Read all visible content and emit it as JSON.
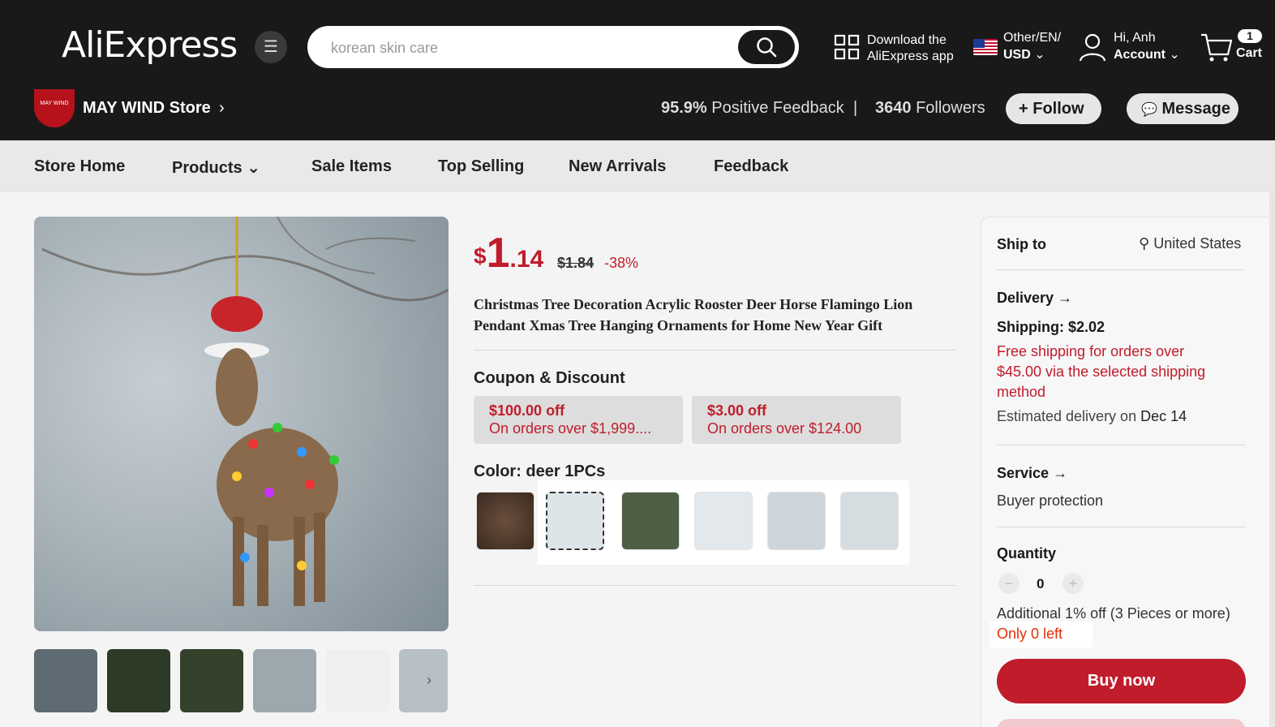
{
  "header": {
    "logo": "AliExpress",
    "search_placeholder": "korean skin care",
    "download_line1": "Download the",
    "download_line2": "AliExpress app",
    "locale_line1": "Other/EN/",
    "locale_line2": "USD",
    "account_line1": "Hi, Anh",
    "account_line2": "Account",
    "cart_count": "1",
    "cart_label": "Cart"
  },
  "store": {
    "logo_text": "MAY WIND",
    "name": "MAY WIND Store",
    "feedback_pct": "95.9%",
    "feedback_label": "Positive Feedback",
    "followers_count": "3640",
    "followers_label": "Followers",
    "follow_label": "Follow",
    "message_label": "Message"
  },
  "nav": [
    "Store Home",
    "Products",
    "Sale Items",
    "Top Selling",
    "New Arrivals",
    "Feedback"
  ],
  "product": {
    "currency": "$",
    "price_int": "1",
    "price_dec": ".14",
    "original_price": "$1.84",
    "discount": "-38%",
    "title": "Christmas Tree Decoration Acrylic Rooster Deer Horse Flamingo Lion Pendant Xmas Tree Hanging Ornaments for Home New Year Gift",
    "coupon_heading": "Coupon & Discount",
    "coupons": [
      {
        "amount": "$100.00 off",
        "condition": "On orders over $1,999...."
      },
      {
        "amount": "$3.00 off",
        "condition": "On orders over $124.00"
      }
    ],
    "color_label": "Color: deer 1PCs"
  },
  "panel": {
    "ship_to_label": "Ship to",
    "ship_to_value": "United States",
    "delivery_label": "Delivery",
    "shipping": "Shipping: $2.02",
    "free_shipping_1": "Free shipping for orders over",
    "free_shipping_2": "$45.00 via the selected shipping",
    "free_shipping_3": "method",
    "estimated_prefix": "Estimated delivery on",
    "estimated_date": "Dec 14",
    "service_label": "Service",
    "service_value": "Buyer protection",
    "quantity_label": "Quantity",
    "quantity_value": "0",
    "additional_off": "Additional 1% off (3 Pieces or more)",
    "stock_text": "Only 0 left",
    "buy_now": "Buy now"
  },
  "colors": {
    "accent": "#c01c2b",
    "header_bg": "#191919"
  }
}
